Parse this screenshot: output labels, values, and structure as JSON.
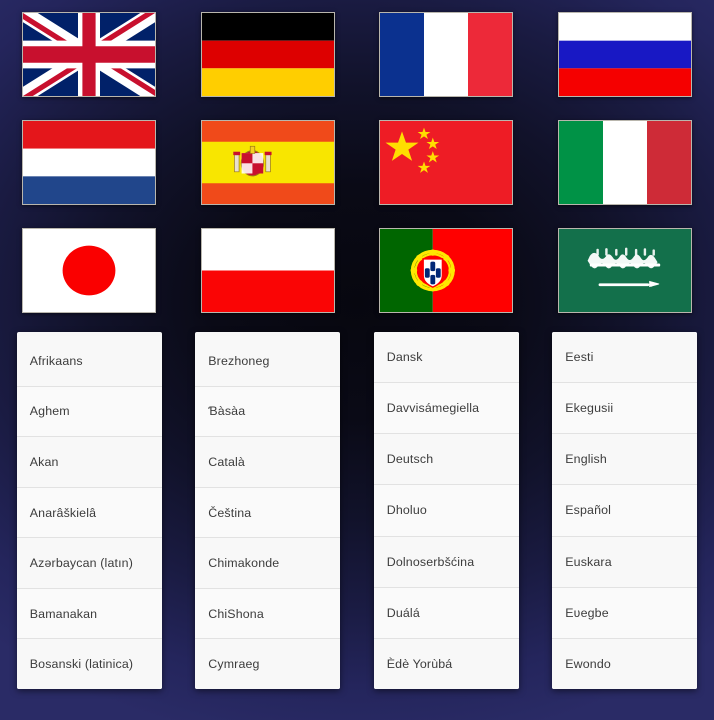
{
  "flags": [
    {
      "name": "united-kingdom",
      "label": "United Kingdom"
    },
    {
      "name": "germany",
      "label": "Germany"
    },
    {
      "name": "france",
      "label": "France"
    },
    {
      "name": "russia",
      "label": "Russia"
    },
    {
      "name": "netherlands",
      "label": "Netherlands"
    },
    {
      "name": "spain",
      "label": "Spain"
    },
    {
      "name": "china",
      "label": "China"
    },
    {
      "name": "italy",
      "label": "Italy"
    },
    {
      "name": "japan",
      "label": "Japan"
    },
    {
      "name": "poland",
      "label": "Poland"
    },
    {
      "name": "portugal",
      "label": "Portugal"
    },
    {
      "name": "saudi-arabia",
      "label": "Saudi Arabia"
    }
  ],
  "columns": [
    {
      "index": 1,
      "items": [
        "Afrikaans",
        "Aghem",
        "Akan",
        "Anarâškielâ",
        "Azərbaycan (latın)",
        "Bamanakan",
        "Bosanski (latinica)"
      ]
    },
    {
      "index": 2,
      "items": [
        "Brezhoneg",
        "Ɓàsàa",
        "Català",
        "Čeština",
        "Chimakonde",
        "ChiShona",
        "Cymraeg"
      ]
    },
    {
      "index": 3,
      "items": [
        "Dansk",
        "Davvisámegiella",
        "Deutsch",
        "Dholuo",
        "Dolnoserbšćina",
        "Duálá",
        "Èdè Yorùbá"
      ]
    },
    {
      "index": 4,
      "items": [
        "Eesti",
        "Ekegusii",
        "English",
        "Español",
        "Euskara",
        "Eʋegbe",
        "Ewondo"
      ]
    }
  ],
  "colors": {
    "background_edge": "#262a6e",
    "background_center": "#07070f",
    "card_background": "#f7f7f7",
    "card_text": "#3c3c3c",
    "card_divider": "#e2e2e2"
  }
}
